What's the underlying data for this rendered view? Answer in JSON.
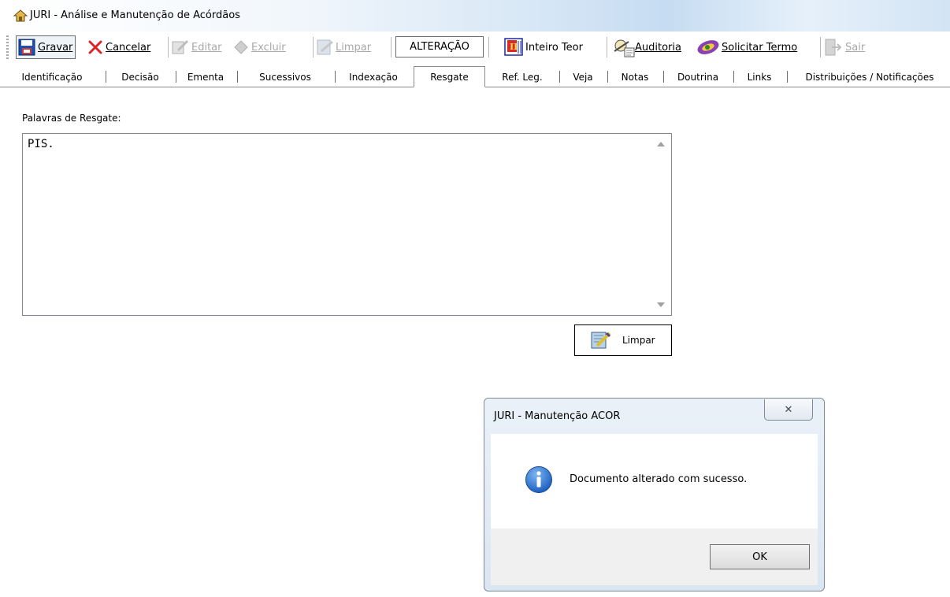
{
  "window": {
    "title": "JURI - Análise e Manutenção de Acórdãos"
  },
  "toolbar": {
    "gravar": "Gravar",
    "cancelar": "Cancelar",
    "editar": "Editar",
    "excluir": "Excluir",
    "limpar": "Limpar",
    "mode": "ALTERAÇÃO",
    "inteiro_teor": "Inteiro Teor",
    "auditoria": "Auditoria",
    "solicitar_termo": "Solicitar Termo",
    "sair": "Sair"
  },
  "tabs": [
    {
      "label": "Identificação"
    },
    {
      "label": "Decisão"
    },
    {
      "label": "Ementa"
    },
    {
      "label": "Sucessivos"
    },
    {
      "label": "Indexação"
    },
    {
      "label": "Resgate",
      "active": true
    },
    {
      "label": "Ref. Leg."
    },
    {
      "label": "Veja"
    },
    {
      "label": "Notas"
    },
    {
      "label": "Doutrina"
    },
    {
      "label": "Links"
    },
    {
      "label": "Distribuições / Notificações"
    }
  ],
  "resgate": {
    "label": "Palavras de Resgate:",
    "value": "PIS.",
    "limpar_button": "Limpar"
  },
  "dialog": {
    "title": "JURI - Manutenção ACOR",
    "close": "✕",
    "message": "Documento alterado com sucesso.",
    "ok": "OK"
  },
  "colors": {
    "accent": "#1b66c9",
    "disabled": "#a8a8a8"
  },
  "icons": [
    "app-icon",
    "save-icon",
    "cancel-icon",
    "edit-icon",
    "delete-icon",
    "clear-icon",
    "book-icon",
    "audit-icon",
    "request-icon",
    "exit-icon",
    "info-icon"
  ]
}
